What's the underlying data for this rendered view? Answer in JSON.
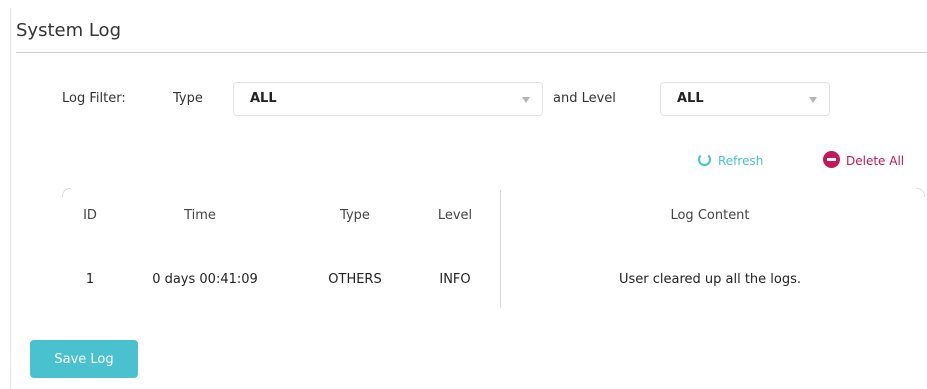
{
  "page": {
    "title": "System Log"
  },
  "filter": {
    "label": "Log Filter:",
    "type_label": "Type",
    "type_value": "ALL",
    "level_label": "and Level",
    "level_value": "ALL"
  },
  "actions": {
    "refresh_label": "Refresh",
    "delete_all_label": "Delete All"
  },
  "table": {
    "headers": {
      "id": "ID",
      "time": "Time",
      "type": "Type",
      "level": "Level",
      "content": "Log Content"
    },
    "rows": [
      {
        "id": "1",
        "time": "0 days 00:41:09",
        "type": "OTHERS",
        "level": "INFO",
        "content": "User cleared up all the logs."
      }
    ]
  },
  "footer": {
    "save_label": "Save Log"
  },
  "colors": {
    "accent": "#4ac1cf",
    "danger": "#c0195c"
  }
}
